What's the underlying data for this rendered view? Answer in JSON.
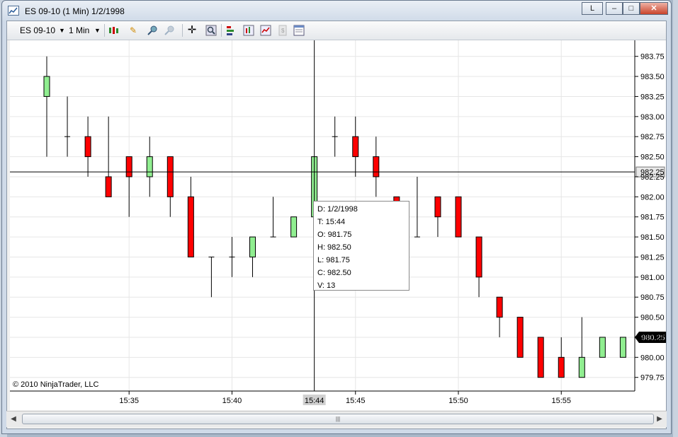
{
  "window": {
    "title": "ES 09-10 (1 Min)  1/2/1998",
    "buttons": {
      "link": "L",
      "minimize": "–",
      "maximize": "□",
      "close": "✕"
    }
  },
  "toolbar": {
    "instrument": "ES 09-10",
    "interval": "1 Min",
    "icons": [
      "bar-type-icon",
      "draw-pen-icon",
      "zoom-in-icon",
      "zoom-out-icon",
      "crosshair-icon",
      "search-icon",
      "strategies-icon",
      "indicators-icon",
      "data-box-icon",
      "save-icon",
      "properties-icon"
    ]
  },
  "copyright": "© 2010 NinjaTrader, LLC",
  "colors": {
    "up": "#90ee90",
    "down": "#ff0000",
    "grid": "#e6e6e6",
    "crosshair": "#000000"
  },
  "crosshair": {
    "time": "15:44",
    "price_label": "982.25",
    "price": 982.31,
    "bar_index": 14
  },
  "last_price_label": "980.25",
  "tooltip": {
    "date": "D: 1/2/1998",
    "time": "T: 15:44",
    "open": "O: 981.75",
    "high": "H: 982.50",
    "low": "L: 981.75",
    "close": "C: 982.50",
    "volume": "V: 13"
  },
  "chart_data": {
    "type": "candlestick",
    "ylim": [
      979.58,
      983.95
    ],
    "y_ticks": [
      "979.75",
      "980.00",
      "980.25",
      "980.50",
      "980.75",
      "981.00",
      "981.25",
      "981.50",
      "981.75",
      "982.00",
      "982.25",
      "982.50",
      "982.75",
      "983.00",
      "983.25",
      "983.50",
      "983.75"
    ],
    "x_ticks": [
      {
        "label": "15:35",
        "at": 4
      },
      {
        "label": "15:40",
        "at": 9
      },
      {
        "label": "15:45",
        "at": 15
      },
      {
        "label": "15:50",
        "at": 20
      },
      {
        "label": "15:55",
        "at": 25
      }
    ],
    "bars": [
      {
        "t": "15:31",
        "o": 983.25,
        "h": 983.75,
        "l": 982.5,
        "c": 983.5
      },
      {
        "t": "15:32",
        "o": 982.75,
        "h": 983.25,
        "l": 982.5,
        "c": 982.75
      },
      {
        "t": "15:33",
        "o": 982.75,
        "h": 983.0,
        "l": 982.25,
        "c": 982.5
      },
      {
        "t": "15:34",
        "o": 982.25,
        "h": 983.0,
        "l": 982.0,
        "c": 982.0
      },
      {
        "t": "15:35",
        "o": 982.5,
        "h": 982.5,
        "l": 981.75,
        "c": 982.25
      },
      {
        "t": "15:36",
        "o": 982.25,
        "h": 982.75,
        "l": 982.0,
        "c": 982.5
      },
      {
        "t": "15:37",
        "o": 982.5,
        "h": 982.5,
        "l": 981.75,
        "c": 982.0
      },
      {
        "t": "15:38",
        "o": 982.0,
        "h": 982.25,
        "l": 981.25,
        "c": 981.25
      },
      {
        "t": "15:39",
        "o": 981.25,
        "h": 981.25,
        "l": 980.75,
        "c": 981.25
      },
      {
        "t": "15:40",
        "o": 981.25,
        "h": 981.5,
        "l": 981.0,
        "c": 981.25
      },
      {
        "t": "15:41",
        "o": 981.25,
        "h": 981.5,
        "l": 981.0,
        "c": 981.5
      },
      {
        "t": "15:42",
        "o": 981.5,
        "h": 982.0,
        "l": 981.5,
        "c": 981.5
      },
      {
        "t": "15:43",
        "o": 981.5,
        "h": 981.75,
        "l": 981.5,
        "c": 981.75
      },
      {
        "t": "15:44",
        "o": 981.75,
        "h": 982.5,
        "l": 981.75,
        "c": 982.5
      },
      {
        "t": "15:45",
        "o": 982.75,
        "h": 983.0,
        "l": 982.5,
        "c": 982.75
      },
      {
        "t": "15:46",
        "o": 982.75,
        "h": 983.0,
        "l": 982.25,
        "c": 982.5
      },
      {
        "t": "15:47",
        "o": 982.5,
        "h": 982.75,
        "l": 982.0,
        "c": 982.25
      },
      {
        "t": "15:48",
        "o": 982.0,
        "h": 982.0,
        "l": 981.75,
        "c": 981.75
      },
      {
        "t": "15:49",
        "o": 981.5,
        "h": 982.25,
        "l": 981.5,
        "c": 981.5
      },
      {
        "t": "15:50",
        "o": 982.0,
        "h": 982.0,
        "l": 981.5,
        "c": 981.75
      },
      {
        "t": "15:51",
        "o": 982.0,
        "h": 982.0,
        "l": 981.5,
        "c": 981.5
      },
      {
        "t": "15:52",
        "o": 981.5,
        "h": 981.5,
        "l": 980.75,
        "c": 981.0
      },
      {
        "t": "15:53",
        "o": 980.75,
        "h": 980.75,
        "l": 980.25,
        "c": 980.5
      },
      {
        "t": "15:54",
        "o": 980.5,
        "h": 980.5,
        "l": 980.0,
        "c": 980.0
      },
      {
        "t": "15:55",
        "o": 980.25,
        "h": 980.25,
        "l": 979.75,
        "c": 979.75
      },
      {
        "t": "15:56",
        "o": 980.0,
        "h": 980.25,
        "l": 979.75,
        "c": 979.75
      },
      {
        "t": "15:57",
        "o": 979.75,
        "h": 980.5,
        "l": 979.75,
        "c": 980.0
      },
      {
        "t": "15:58",
        "o": 980.0,
        "h": 980.25,
        "l": 980.0,
        "c": 980.25
      },
      {
        "t": "15:59",
        "o": 980.0,
        "h": 980.25,
        "l": 980.0,
        "c": 980.25
      }
    ]
  }
}
